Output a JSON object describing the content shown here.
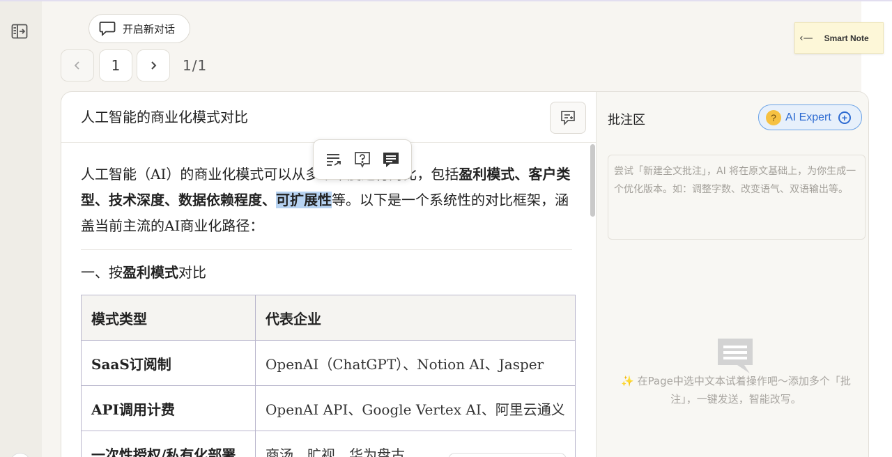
{
  "toolbar": {
    "new_chat_label": "开启新对话"
  },
  "pager": {
    "current_page": "1",
    "total": "1/1"
  },
  "smart_note": {
    "arrow": "‹—",
    "label": "Smart Note"
  },
  "document": {
    "title": "人工智能的商业化模式对比",
    "intro": {
      "p1": "人工智能（AI）的商业化模式可以从多个维度进行对比，包括",
      "b1": "盈利模式、客户类型、技术深度、数据依赖程度、",
      "highlight": "可扩展性",
      "p2": "等。以下是一个系统性的对比框架，涵盖当前主流的AI商业化路径："
    },
    "section": {
      "prefix": "一、按",
      "bold": "盈利模式",
      "suffix": "对比"
    },
    "table": {
      "headers": [
        "模式类型",
        "代表企业"
      ],
      "rows": [
        [
          "SaaS订阅制",
          "OpenAI（ChatGPT）、Notion AI、Jasper"
        ],
        [
          "API调用计费",
          "OpenAI API、Google Vertex AI、阿里云通义"
        ],
        [
          "一次性授权/私有化部署",
          "商汤、旷视、华为盘古"
        ]
      ]
    }
  },
  "annotation": {
    "title": "批注区",
    "ai_expert_label": "AI Expert",
    "input_placeholder": "尝试「新建全文批注」，AI 将在原文基础上，为你生成一个优化版本。如：调整字数、改变语气、双语输出等。",
    "hint_spark": "✨",
    "hint": "在Page中选中文本试着操作吧～添加多个「批注」，一键发送，智能改写。"
  },
  "icons": {
    "sidebar_toggle": "sidebar-toggle-icon",
    "chat_bubble": "chat-bubble-icon",
    "add_note": "add-note-icon",
    "toolbar_rewrite": "rewrite-icon",
    "toolbar_question": "question-icon",
    "toolbar_comment": "comment-icon",
    "ai_expert_emoji": "thinking-face-icon",
    "plus": "plus-circle-icon",
    "empty": "empty-comment-icon"
  },
  "colors": {
    "highlight": "#b7d3f2",
    "ai_expert_accent": "#2c6ad1",
    "smart_note_bg": "#fdf7d8"
  }
}
